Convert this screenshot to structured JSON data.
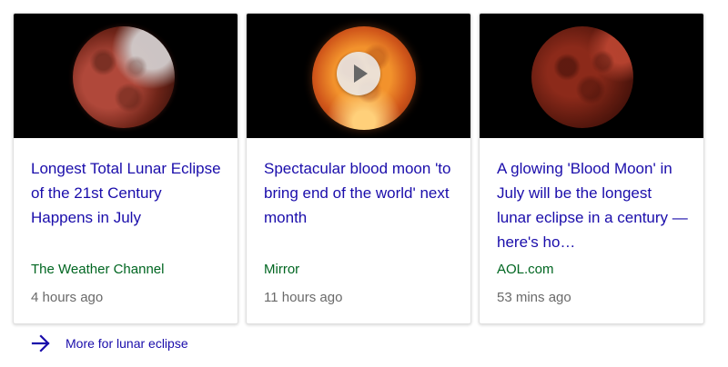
{
  "cards": [
    {
      "headline": "Longest Total Lunar Eclipse of the 21st Century Happens in July",
      "source": "The Weather Channel",
      "time": "4 hours ago",
      "has_video": false
    },
    {
      "headline": "Spectacular blood moon 'to bring end of the world' next month",
      "source": "Mirror",
      "time": "11 hours ago",
      "has_video": true
    },
    {
      "headline": "A glowing 'Blood Moon' in July will be the longest lunar eclipse in a century — here's ho…",
      "source": "AOL.com",
      "time": "53 mins ago",
      "has_video": false
    }
  ],
  "more": {
    "label": "More for lunar eclipse",
    "icon": "arrow-right-icon"
  },
  "colors": {
    "link": "#1a0dab",
    "source": "#006621",
    "meta": "#6a6a6a"
  }
}
